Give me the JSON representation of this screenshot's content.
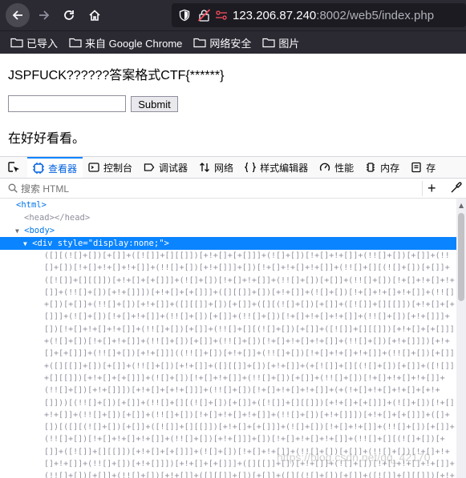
{
  "browser": {
    "url_host": "123.206.87.240",
    "url_rest": ":8002/web5/index.php"
  },
  "bookmarks": [
    {
      "label": "已导入"
    },
    {
      "label": "来自 Google Chrome"
    },
    {
      "label": "网络安全"
    },
    {
      "label": "图片"
    }
  ],
  "page": {
    "title": "JSPFUCK??????答案格式CTF{******}",
    "input_value": "",
    "submit_label": "Submit",
    "hint": "在好好看看。"
  },
  "devtools": {
    "tabs": [
      {
        "label": "查看器",
        "icon": "inspector-icon",
        "active": true
      },
      {
        "label": "控制台",
        "icon": "console-icon",
        "active": false
      },
      {
        "label": "调试器",
        "icon": "debugger-icon",
        "active": false
      },
      {
        "label": "网络",
        "icon": "network-icon",
        "active": false
      },
      {
        "label": "样式编辑器",
        "icon": "style-editor-icon",
        "active": false
      },
      {
        "label": "性能",
        "icon": "performance-icon",
        "active": false
      },
      {
        "label": "内存",
        "icon": "memory-icon",
        "active": false
      },
      {
        "label": "存",
        "icon": "storage-icon",
        "active": false
      }
    ],
    "search_placeholder": "搜索 HTML",
    "tree": {
      "html_open": "<html>",
      "head": "<head></head>",
      "body_open": "<body>",
      "div_tag": "<div ",
      "div_attr": "style",
      "div_eq": "=",
      "div_val": "\"display:none;\"",
      "div_close": ">",
      "code": "([][(![]+[])[+[]]+([![]]+[][[]])[+!+[]+[+[]]]+(![]+[])[!+[]+!+[]]+(!![]+[])[+[]]+(!![]+[])[!+[]+!+[]+!+[]]+(!![]+[])[+!+[]]]+[])[!+[]+!+[]+!+[]]+(!![]+[][(![]+[])[+[]]+([![]]+[][[]])[+!+[]+[+[]]]+(![]+[])[!+[]+!+[]]+(!![]+[])[+[]]+(!![]+[])[!+[]+!+[]+!+[]]+(!![]+[])[+!+[]]])[+!+[]+[+[]]]+([][[]]+[])[+!+[]]+(![]+[])[!+[]+!+[]+!+[]]+(!![]+[])[+[]]+(!![]+[])[+!+[]]+([][[]]+[])[+[]]+([][(![]+[])[+[]]+([![]]+[][[]])[+!+[]+[+[]]]+(![]+[])[!+[]+!+[]]+(!![]+[])[+[]]+(!![]+[])[!+[]+!+[]+!+[]]+(!![]+[])[+!+[]]]+[])[!+[]+!+[]+!+[]]+(!![]+[])[+[]]+(!![]+[][(![]+[])[+[]]+([![]]+[][[]])[+!+[]+[+[]]]+(![]+[])[!+[]+!+[]]+(!![]+[])[+[]]+(!![]+[])[!+[]+!+[]+!+[]]+(!![]+[])[+!+[]]])[+!+[]+[+[]]]+(!![]+[])[+!+[]]]((!![]+[])[+!+[]]+(!![]+[])[!+[]+!+[]+!+[]]+(!![]+[])[+[]]+([][[]]+[])[+[]]+(!![]+[])[+!+[]]+([][[]]+[])[+!+[]]+(+[![]]+[][(![]+[])[+[]]+([![]]+[][[]])[+!+[]+[+[]]]+(![]+[])[!+[]+!+[]]+(!![]+[])[+[]]+(!![]+[])[!+[]+!+[]+!+[]]+(!![]+[])[+!+[]]])[+!+[]+[+!+[]]]+(!![]+[])[!+[]+!+[]+!+[]]+(+(!+[]+!+[]+!+[]+[+!+[]]))[(!![]+[])[+[]]+(!![]+[][(![]+[])[+[]]+([![]]+[][[]])[+!+[]+[+[]]]+(![]+[])[!+[]+!+[]]+(!![]+[])[+[]]+(!![]+[])[!+[]+!+[]+!+[]]+(!![]+[])[+!+[]]])[+!+[]+[+[]]]+([]+[])[([][(![]+[])[+[]]+([![]]+[][[]])[+!+[]+[+[]]]+(![]+[])[!+[]+!+[]]+(!![]+[])[+[]]+(!![]+[])[!+[]+!+[]+!+[]]+(!![]+[])[+!+[]]]+[])[!+[]+!+[]+!+[]]+(!![]+[][(![]+[])[+[]]+([![]]+[][[]])[+!+[]+[+[]]]+(![]+[])[!+[]+!+[]]+(!![]+[])[+[]]+(!![]+[])[!+[]+!+[]+!+[]]+(!![]+[])[+!+[]]])[+!+[]+[+[]]]+([][[]]+[])[+!+[]]+(![]+[])[!+[]+!+[]+!+[]]+(!![]+[])[+[]]+(!![]+[])[+!+[]]+([][[]]+[])[+[]]+([][(![]+[])[+[]]+([![]]+[][[]])[+!+[]+[+[]]]+(![]+[])[!+[]+!+[]]+(!![]+[])[+[]]+(!![]+[])[!+[]+!+[]+!+[]]+(!![]+[])[+!+[]]]+[])[!+[]+!+[]+!+[]]+(!![]+[])[+[]]+(!![]+[][(![]+[])[+[]]+([![]]+[][[]])[+!+[]+[+[]]]+(![]+[])[!+[]+!+[]]+(!![]+[])[+[]]+(!![]+[])[!+[]+!+[]+!+[]]+(!![]+[])[+!+[]]])[+!+[]+[+[]]]+(!![]+[])[+!+[]]][([][[]]+[])[+!+[]]+(![]+[])[+!+[]]+((+[])[([][(![]+[])[+[]]+([![]]+[][[]])[+!+[]+[+[]]]+(![]+[])[!+[]+!+[]]+(!![]+[])[+[]]+(!![]+[])[!+[]+!+[]+!+[]]+(!![]+[])[+!+[]]]+[])[!+[]+!+[]+!+[]]"
    }
  },
  "watermark": "https://blog.csdn.net/qq_42170"
}
